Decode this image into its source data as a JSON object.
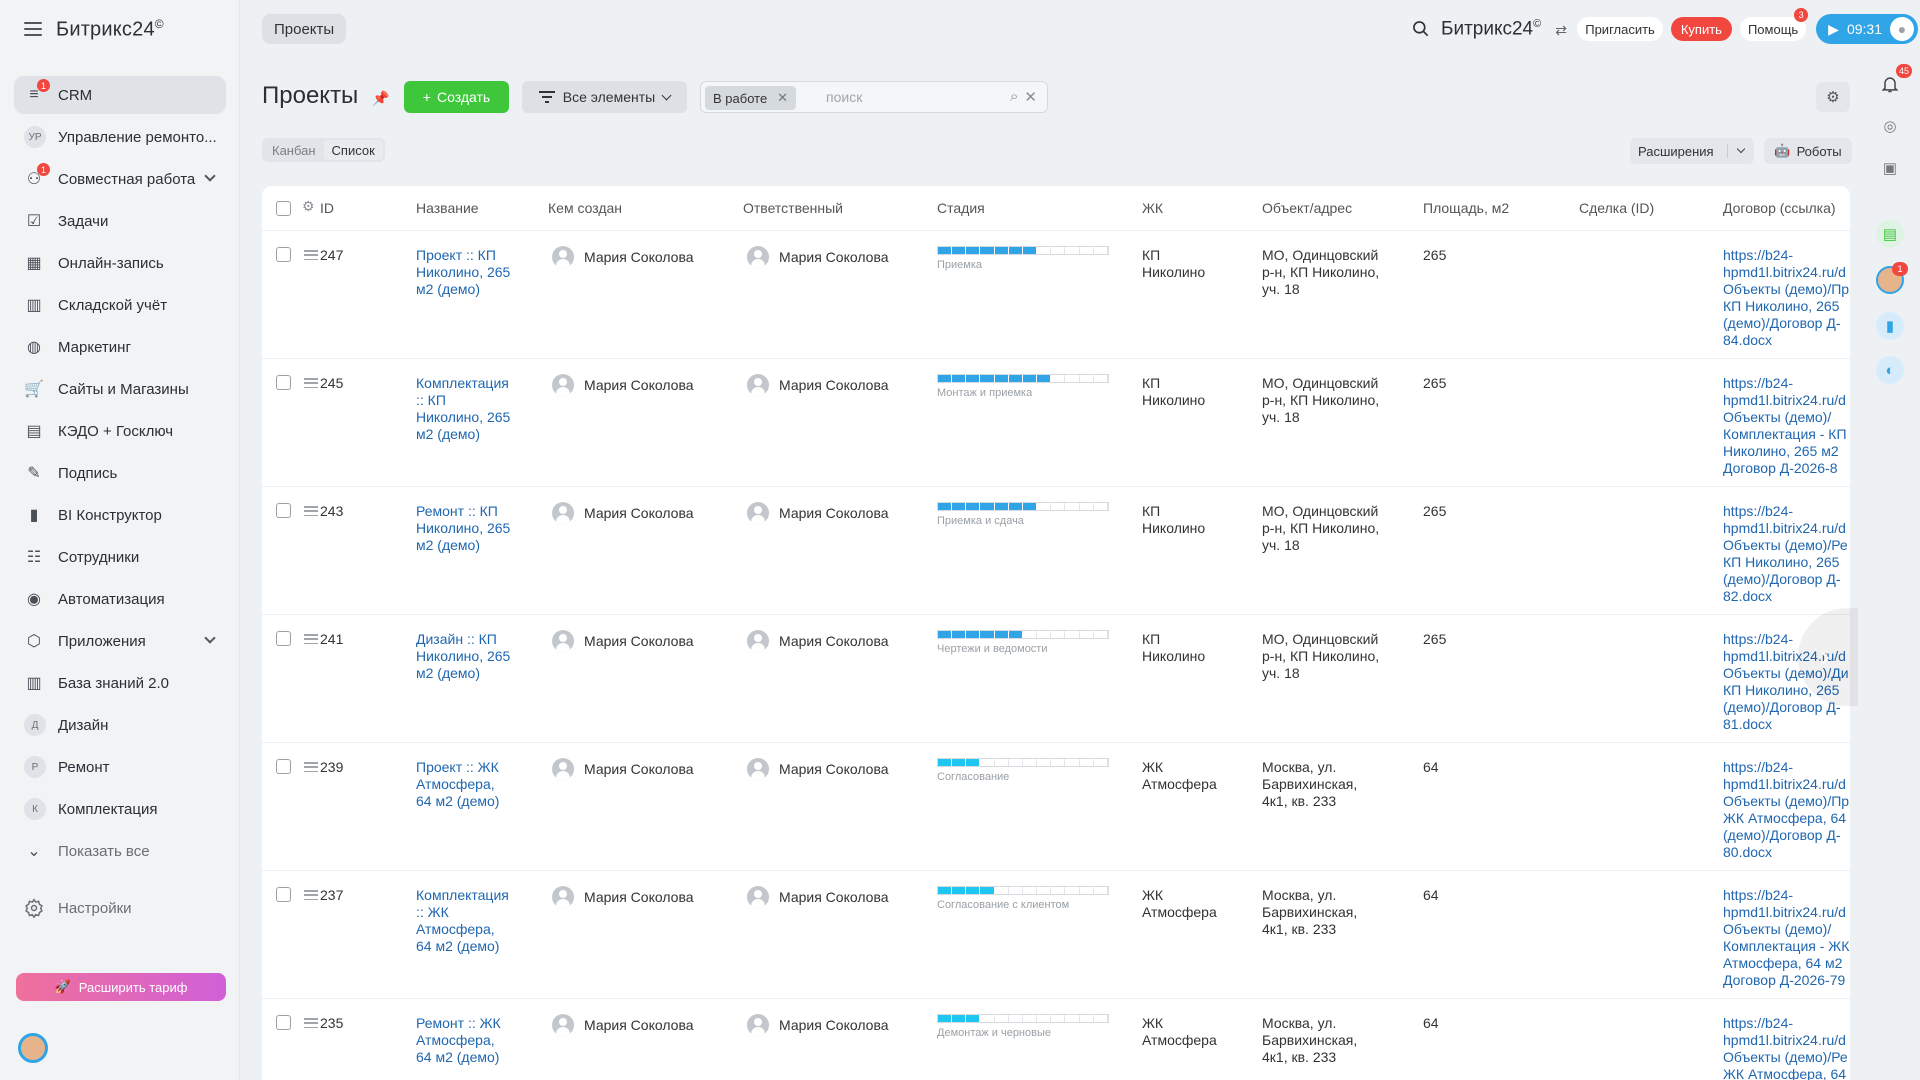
{
  "brand": {
    "name": "Битрикс24",
    "mark": "©"
  },
  "sidebar": {
    "items": [
      {
        "label": "CRM",
        "icon": "crm-filter-icon",
        "badge": "1",
        "active": true
      },
      {
        "label": "Управление ремонто...",
        "letter": "УР"
      },
      {
        "label": "Совместная работа",
        "icon": "collab-icon",
        "badge": "1",
        "chevron": true
      },
      {
        "label": "Задачи",
        "icon": "tasks-checkbox-icon"
      },
      {
        "label": "Онлайн-запись",
        "icon": "calendar-icon"
      },
      {
        "label": "Складской учёт",
        "icon": "warehouse-icon"
      },
      {
        "label": "Маркетинг",
        "icon": "marketing-icon"
      },
      {
        "label": "Сайты и Магазины",
        "icon": "cart-icon"
      },
      {
        "label": "КЭДО + Госключ",
        "icon": "document-icon"
      },
      {
        "label": "Подпись",
        "icon": "signature-icon"
      },
      {
        "label": "BI Конструктор",
        "icon": "chart-bars-icon"
      },
      {
        "label": "Сотрудники",
        "icon": "employees-icon"
      },
      {
        "label": "Автоматизация",
        "icon": "robot-icon"
      },
      {
        "label": "Приложения",
        "icon": "apps-cube-icon",
        "chevron": true
      },
      {
        "label": "База знаний 2.0",
        "icon": "books-icon"
      },
      {
        "label": "Дизайн",
        "letter": "Д"
      },
      {
        "label": "Ремонт",
        "letter": "Р"
      },
      {
        "label": "Комплектация",
        "letter": "К"
      },
      {
        "label": "Показать все",
        "icon": "chevron-down-icon",
        "muted": true
      }
    ],
    "settings_label": "Настройки",
    "tariff_label": "Расширить тариф"
  },
  "topbar": {
    "breadcrumb": "Проекты",
    "invite_label": "Пригласить",
    "buy_label": "Купить",
    "help_label": "Помощь",
    "help_badge": "3",
    "timer": "09:31"
  },
  "page": {
    "title": "Проекты",
    "create_label": "Создать",
    "all_items_label": "Все элементы",
    "filter_chip": "В работе",
    "search_placeholder": "поиск",
    "view_kanban": "Канбан",
    "view_list": "Список",
    "extensions_label": "Расширения",
    "robots_label": "Роботы"
  },
  "grid": {
    "columns": [
      "ID",
      "Название",
      "Кем создан",
      "Ответственный",
      "Стадия",
      "ЖК",
      "Объект/адрес",
      "Площадь, м2",
      "Сделка (ID)",
      "Договор (ссылка)"
    ],
    "rows": [
      {
        "id": "247",
        "name": [
          "Проект :: КП",
          "Николино, 265",
          "м2 (демо)"
        ],
        "created_by": "Мария Соколова",
        "responsible": "Мария Соколова",
        "stage": "Приемка",
        "stage_segments": 7,
        "stage_color": "#2fa4e7",
        "zhk": [
          "КП",
          "Николино"
        ],
        "address": [
          "МО, Одинцовский",
          "р-н, КП Николино,",
          "уч. 18"
        ],
        "area": "265",
        "deal": "",
        "contract": [
          "https://b24-",
          "hpmd1l.bitrix24.ru/d",
          "Объекты (демо)/Пр",
          "КП Николино, 265",
          "(демо)/Договор Д-",
          "84.docx"
        ]
      },
      {
        "id": "245",
        "name": [
          "Комплектация",
          ":: КП",
          "Николино, 265",
          "м2 (демо)"
        ],
        "created_by": "Мария Соколова",
        "responsible": "Мария Соколова",
        "stage": "Монтаж и приемка",
        "stage_segments": 8,
        "stage_color": "#2fa4e7",
        "zhk": [
          "КП",
          "Николино"
        ],
        "address": [
          "МО, Одинцовский",
          "р-н, КП Николино,",
          "уч. 18"
        ],
        "area": "265",
        "deal": "",
        "contract": [
          "https://b24-",
          "hpmd1l.bitrix24.ru/d",
          "Объекты (демо)/",
          "Комплектация - КП",
          "Николино, 265 м2",
          "Договор Д-2026-8"
        ]
      },
      {
        "id": "243",
        "name": [
          "Ремонт :: КП",
          "Николино, 265",
          "м2 (демо)"
        ],
        "created_by": "Мария Соколова",
        "responsible": "Мария Соколова",
        "stage": "Приемка и сдача",
        "stage_segments": 7,
        "stage_color": "#2fa4e7",
        "zhk": [
          "КП",
          "Николино"
        ],
        "address": [
          "МО, Одинцовский",
          "р-н, КП Николино,",
          "уч. 18"
        ],
        "area": "265",
        "deal": "",
        "contract": [
          "https://b24-",
          "hpmd1l.bitrix24.ru/d",
          "Объекты (демо)/Ре",
          "КП Николино, 265",
          "(демо)/Договор Д-",
          "82.docx"
        ]
      },
      {
        "id": "241",
        "name": [
          "Дизайн :: КП",
          "Николино, 265",
          "м2 (демо)"
        ],
        "created_by": "Мария Соколова",
        "responsible": "Мария Соколова",
        "stage": "Чертежи и ведомости",
        "stage_segments": 6,
        "stage_color": "#2fa4e7",
        "zhk": [
          "КП",
          "Николино"
        ],
        "address": [
          "МО, Одинцовский",
          "р-н, КП Николино,",
          "уч. 18"
        ],
        "area": "265",
        "deal": "",
        "contract": [
          "https://b24-",
          "hpmd1l.bitrix24.ru/d",
          "Объекты (демо)/Ди",
          "КП Николино, 265",
          "(демо)/Договор Д-",
          "81.docx"
        ]
      },
      {
        "id": "239",
        "name": [
          "Проект :: ЖК",
          "Атмосфера,",
          "64 м2 (демо)"
        ],
        "created_by": "Мария Соколова",
        "responsible": "Мария Соколова",
        "stage": "Согласование",
        "stage_segments": 3,
        "stage_color": "#1ec6f0",
        "zhk": [
          "ЖК",
          "Атмосфера"
        ],
        "address": [
          "Москва, ул.",
          "Барвихинская,",
          "4к1, кв. 233"
        ],
        "area": "64",
        "deal": "",
        "contract": [
          "https://b24-",
          "hpmd1l.bitrix24.ru/d",
          "Объекты (демо)/Пр",
          "ЖК Атмосфера, 64",
          "(демо)/Договор Д-",
          "80.docx"
        ]
      },
      {
        "id": "237",
        "name": [
          "Комплектация",
          ":: ЖК",
          "Атмосфера,",
          "64 м2 (демо)"
        ],
        "created_by": "Мария Соколова",
        "responsible": "Мария Соколова",
        "stage": "Согласование с клиентом",
        "stage_segments": 4,
        "stage_color": "#1ec6f0",
        "zhk": [
          "ЖК",
          "Атмосфера"
        ],
        "address": [
          "Москва, ул.",
          "Барвихинская,",
          "4к1, кв. 233"
        ],
        "area": "64",
        "deal": "",
        "contract": [
          "https://b24-",
          "hpmd1l.bitrix24.ru/d",
          "Объекты (демо)/",
          "Комплектация - ЖК",
          "Атмосфера, 64 м2",
          "Договор Д-2026-79"
        ]
      },
      {
        "id": "235",
        "name": [
          "Ремонт :: ЖК",
          "Атмосфера,",
          "64 м2 (демо)"
        ],
        "created_by": "Мария Соколова",
        "responsible": "Мария Соколова",
        "stage": "Демонтаж и черновые",
        "stage_segments": 3,
        "stage_color": "#1ec6f0",
        "zhk": [
          "ЖК",
          "Атмосфера"
        ],
        "address": [
          "Москва, ул.",
          "Барвихинская,",
          "4к1, кв. 233"
        ],
        "area": "64",
        "deal": "",
        "contract": [
          "https://b24-",
          "hpmd1l.bitrix24.ru/d",
          "Объекты (демо)/Ре",
          "ЖК Атмосфера, 64"
        ]
      }
    ]
  },
  "rail": {
    "notifications_badge": "45",
    "avatar_badge": "1"
  }
}
